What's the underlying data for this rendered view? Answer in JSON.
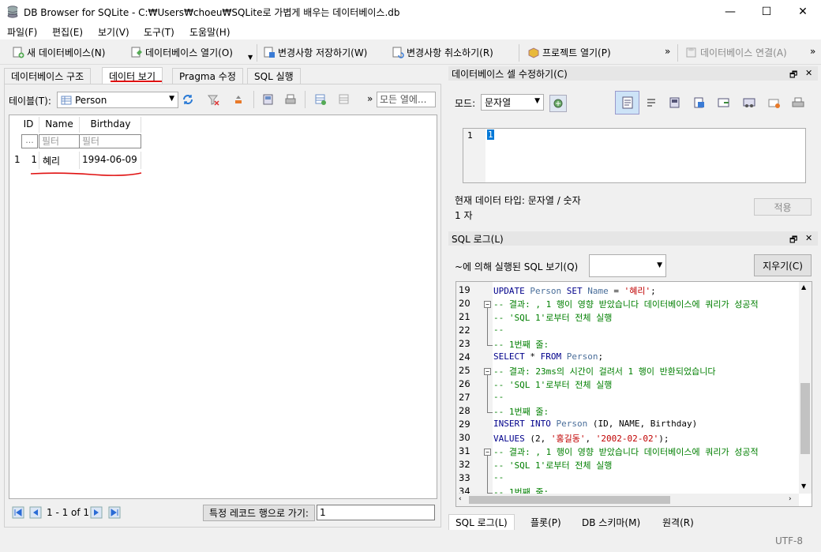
{
  "window": {
    "title": "DB Browser for SQLite - C:₩Users₩choeu₩SQLite로 가볍게 배우는 데이터베이스.db",
    "minimize": "—",
    "maximize": "☐",
    "close": "✕"
  },
  "menu": [
    "파일(F)",
    "편집(E)",
    "보기(V)",
    "도구(T)",
    "도움말(H)"
  ],
  "toolbar": {
    "new_db": "새 데이터베이스(N)",
    "open_db": "데이터베이스 열기(O)",
    "save_changes": "변경사항 저장하기(W)",
    "revert_changes": "변경사항 취소하기(R)",
    "open_project": "프로젝트 열기(P)",
    "attach_db": "데이터베이스 연결(A)",
    "overflow": "»"
  },
  "main_tabs": [
    "데이터베이스 구조",
    "데이터 보기",
    "Pragma 수정",
    "SQL 실행"
  ],
  "browse": {
    "table_label": "테이블(T):",
    "table_value": "Person",
    "filter_placeholder": "모든 열에...",
    "columns": [
      "ID",
      "Name",
      "Birthday"
    ],
    "filter_row": [
      "...",
      "필터",
      "필터"
    ],
    "rows": [
      {
        "rownum": "1",
        "cells": [
          "1",
          "혜리",
          "1994-06-09"
        ]
      }
    ],
    "pager_text": "1 - 1 of 1",
    "goto_label": "특정 레코드 행으로 가기:",
    "goto_value": "1"
  },
  "edit_cell": {
    "title": "데이터베이스 셀 수정하기(C)",
    "mode_label": "모드:",
    "mode_value": "문자열",
    "line_number": "1",
    "cell_value": "1",
    "type_info": "현재 데이터 타입: 문자열 / 숫자",
    "size_info": "1 자",
    "apply_label": "적용"
  },
  "sql_log": {
    "title": "SQL 로그(L)",
    "submitted_by_label": "~에 의해 실행된 SQL 보기(Q)",
    "clear_label": "지우기(C)",
    "lines": [
      {
        "n": "19",
        "parts": [
          [
            "kw",
            "UPDATE "
          ],
          [
            "id",
            "Person "
          ],
          [
            "kw",
            "SET "
          ],
          [
            "id",
            "Name "
          ],
          [
            "pl",
            "= "
          ],
          [
            "st",
            "'혜리'"
          ],
          [
            "pl",
            ";"
          ]
        ]
      },
      {
        "n": "20",
        "parts": [
          [
            "cm",
            "-- 결과: , 1 행이 영향 받았습니다 데이터베이스에 쿼리가 성공적"
          ]
        ]
      },
      {
        "n": "21",
        "parts": [
          [
            "cm",
            "-- 'SQL 1'로부터 전체 실행"
          ]
        ]
      },
      {
        "n": "22",
        "parts": [
          [
            "cm",
            "--"
          ]
        ]
      },
      {
        "n": "23",
        "parts": [
          [
            "cm",
            "-- 1번째 줄:"
          ]
        ]
      },
      {
        "n": "24",
        "parts": [
          [
            "kw",
            "SELECT "
          ],
          [
            "pl",
            "* "
          ],
          [
            "kw",
            "FROM "
          ],
          [
            "id",
            "Person"
          ],
          [
            "pl",
            ";"
          ]
        ]
      },
      {
        "n": "25",
        "parts": [
          [
            "cm",
            "-- 결과: 23ms의 시간이 걸려서 1 행이 반환되었습니다"
          ]
        ]
      },
      {
        "n": "26",
        "parts": [
          [
            "cm",
            "-- 'SQL 1'로부터 전체 실행"
          ]
        ]
      },
      {
        "n": "27",
        "parts": [
          [
            "cm",
            "--"
          ]
        ]
      },
      {
        "n": "28",
        "parts": [
          [
            "cm",
            "-- 1번째 줄:"
          ]
        ]
      },
      {
        "n": "29",
        "parts": [
          [
            "kw",
            "INSERT INTO "
          ],
          [
            "id",
            "Person "
          ],
          [
            "pl",
            "(ID, NAME, Birthday)"
          ]
        ]
      },
      {
        "n": "30",
        "parts": [
          [
            "kw",
            "VALUES "
          ],
          [
            "pl",
            "(2, "
          ],
          [
            "st",
            "'홍길동'"
          ],
          [
            "pl",
            ", "
          ],
          [
            "st",
            "'2002-02-02'"
          ],
          [
            "pl",
            ");"
          ]
        ]
      },
      {
        "n": "31",
        "parts": [
          [
            "cm",
            "-- 결과: , 1 행이 영향 받았습니다 데이터베이스에 쿼리가 성공적"
          ]
        ]
      },
      {
        "n": "32",
        "parts": [
          [
            "cm",
            "-- 'SQL 1'로부터 전체 실행"
          ]
        ]
      },
      {
        "n": "33",
        "parts": [
          [
            "cm",
            "--"
          ]
        ]
      },
      {
        "n": "34",
        "parts": [
          [
            "cm",
            "-- 1번째 줄:"
          ]
        ]
      }
    ]
  },
  "bottom_tabs": [
    "SQL 로그(L)",
    "플롯(P)",
    "DB 스키마(M)",
    "원격(R)"
  ],
  "status": {
    "encoding": "UTF-8"
  },
  "colors": {
    "annotation_red": "#e01010",
    "selection_blue": "#0078d7"
  }
}
